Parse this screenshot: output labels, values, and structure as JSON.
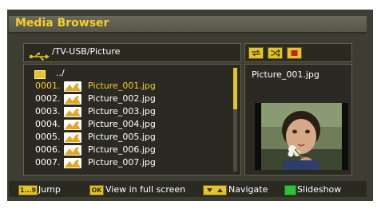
{
  "window": {
    "title": "Media Browser"
  },
  "path": {
    "text": "/TV-USB/Picture"
  },
  "toolbar": {
    "buttons": [
      {
        "name": "repeat-icon"
      },
      {
        "name": "shuffle-icon"
      },
      {
        "name": "stop-icon"
      }
    ]
  },
  "file_list": {
    "updir_label": "../",
    "rows": [
      {
        "number": "0001.",
        "name": "Picture_001.jpg",
        "selected": true
      },
      {
        "number": "0002.",
        "name": "Picture_002.jpg",
        "selected": false
      },
      {
        "number": "0003.",
        "name": "Picture_003.jpg",
        "selected": false
      },
      {
        "number": "0004.",
        "name": "Picture_004.jpg",
        "selected": false
      },
      {
        "number": "0005.",
        "name": "Picture_005.jpg",
        "selected": false
      },
      {
        "number": "0006.",
        "name": "Picture_006.jpg",
        "selected": false
      },
      {
        "number": "0007.",
        "name": "Picture_007.jpg",
        "selected": false
      }
    ]
  },
  "preview": {
    "filename": "Picture_001.jpg"
  },
  "footer": {
    "jump_key": "1...9",
    "jump_label": "Jump",
    "ok_key": "OK",
    "ok_label": "View in full screen",
    "navigate_label": "Navigate",
    "slideshow_label": "Slideshow"
  },
  "colors": {
    "accent": "#f5cf28",
    "background": "#3e3d32",
    "panel": "#2a2a23",
    "green_key": "#2fbf3a"
  }
}
